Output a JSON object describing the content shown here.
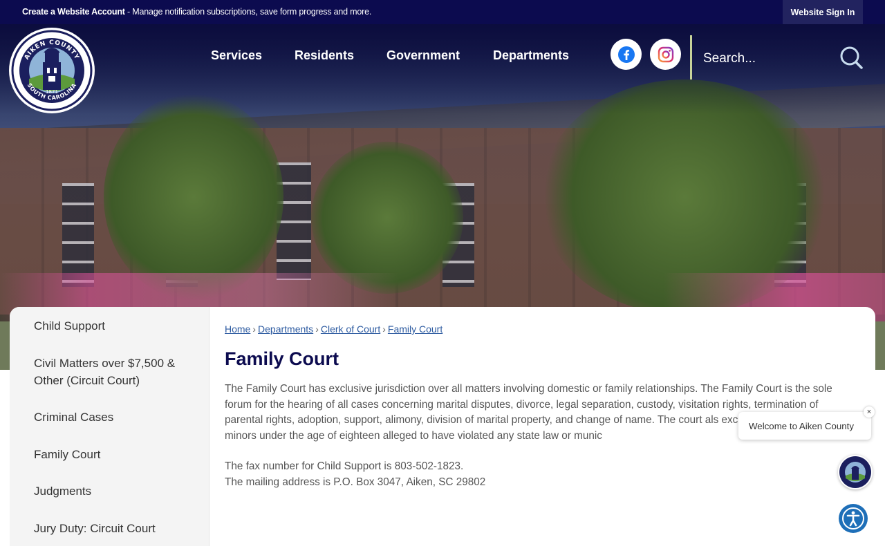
{
  "topbar": {
    "account_link": "Create a Website Account",
    "account_desc": " - Manage notification subscriptions, save form progress and more.",
    "signin": "Website Sign In"
  },
  "logo": {
    "top_text": "AIKEN COUNTY",
    "bottom_text": "SOUTH CAROLINA",
    "year": "1871"
  },
  "nav": {
    "items": [
      "Services",
      "Residents",
      "Government",
      "Departments"
    ]
  },
  "social": {
    "facebook": "facebook-icon",
    "instagram": "instagram-icon"
  },
  "search": {
    "placeholder": "Search..."
  },
  "sidebar": {
    "items": [
      "Child Support",
      "Civil Matters over $7,500 & Other (Circuit Court)",
      "Criminal Cases",
      "Family Court",
      "Judgments",
      "Jury Duty: Circuit Court"
    ]
  },
  "breadcrumb": [
    "Home",
    "Departments",
    "Clerk of Court",
    "Family Court"
  ],
  "page": {
    "title": "Family Court",
    "paragraph": "The Family Court has exclusive jurisdiction over all matters involving domestic or family relationships. The Family Court is the sole forum for the hearing of all cases concerning marital disputes, divorce, legal separation, custody, visitation rights, termination of parental rights, adoption, support, alimony, division of marital property, and change of name.  The court als exclusive jurisdiction over minors under the age of eighteen alleged to have violated any state law or munic",
    "fax": "The fax number for Child Support is 803-502-1823.",
    "mail": "The mailing address is P.O. Box 3047, Aiken, SC 29802"
  },
  "chat": {
    "welcome": "Welcome to Aiken County",
    "close": "×"
  },
  "colors": {
    "navy": "#0c0b4f",
    "link": "#2c5aa0",
    "accent_divider": "#c8d39a",
    "accessibility": "#1e6fb8"
  }
}
